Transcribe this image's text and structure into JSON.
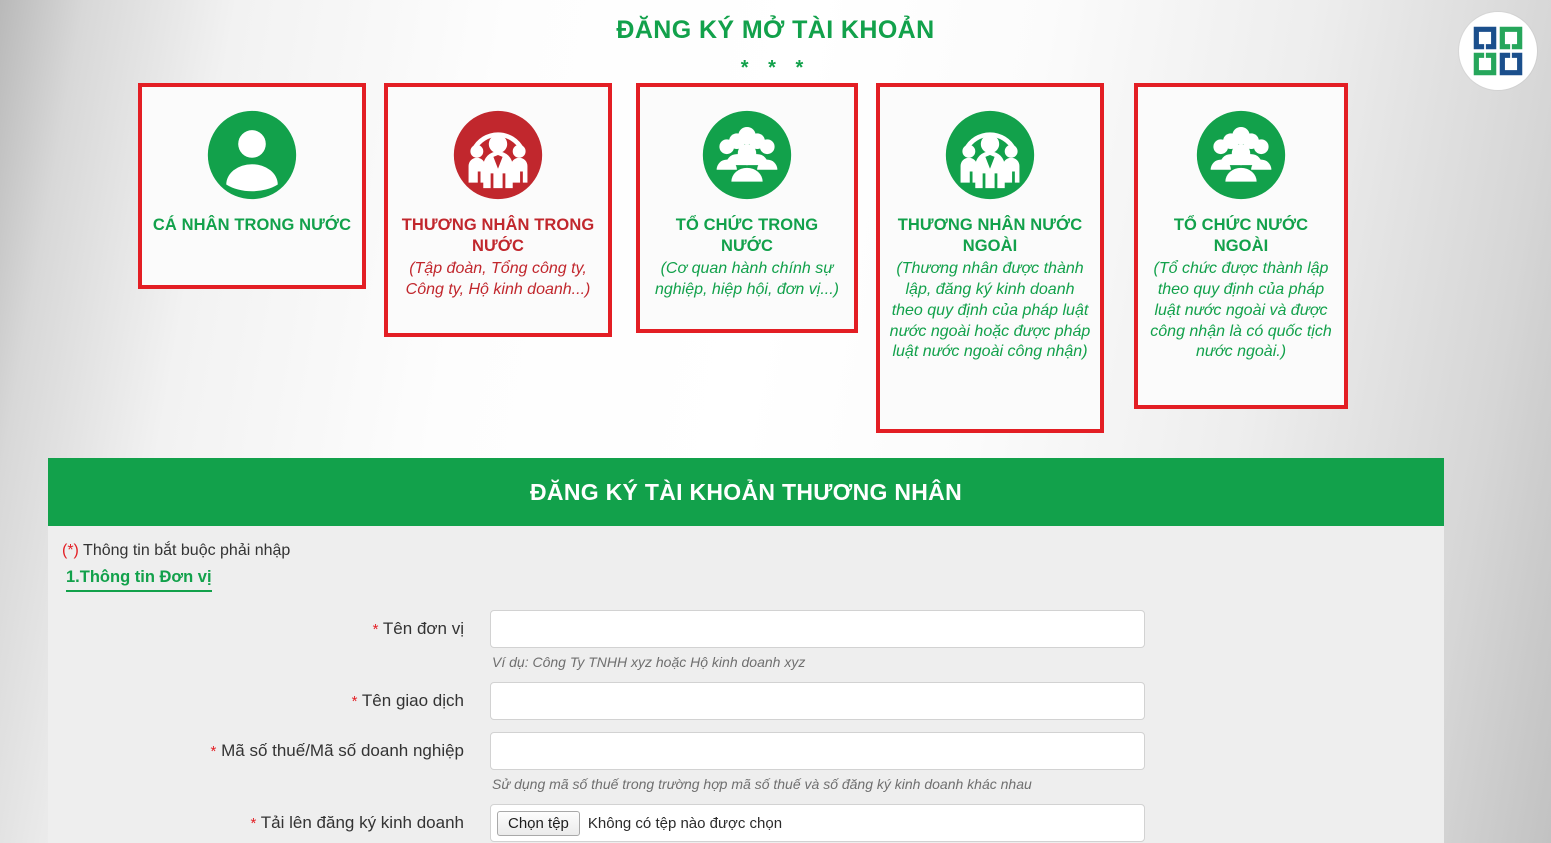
{
  "brand": {
    "logo_icon": "sgg-logo-icon",
    "logo_navy": "#1B4F8C",
    "logo_green": "#26A65B"
  },
  "colors": {
    "green": "#12A14B",
    "red_border": "#E31E24",
    "active_text": "#C1272D"
  },
  "header": {
    "title": "ĐĂNG KÝ MỞ TÀI KHOẢN",
    "stars": "* * *"
  },
  "categories": [
    {
      "id": "ca-nhan-trong-nuoc",
      "icon": "single-person-icon",
      "title": "CÁ NHÂN TRONG NƯỚC",
      "subtitle": "",
      "active": false
    },
    {
      "id": "thuong-nhan-trong-nuoc",
      "icon": "business-team-icon",
      "title": "THƯƠNG NHÂN TRONG NƯỚC",
      "subtitle": "(Tập đoàn, Tổng công ty, Công ty, Hộ kinh doanh...)",
      "active": true
    },
    {
      "id": "to-chuc-trong-nuoc",
      "icon": "crowd-group-icon",
      "title": "TỔ CHỨC TRONG NƯỚC",
      "subtitle": "(Cơ quan hành chính sự nghiệp, hiệp hội, đơn vị...)",
      "active": false
    },
    {
      "id": "thuong-nhan-nuoc-ngoai",
      "icon": "business-team-icon",
      "title": "THƯƠNG NHÂN NƯỚC NGOÀI",
      "subtitle": "(Thương nhân được thành lập, đăng ký kinh doanh theo quy định của pháp luật nước ngoài hoặc được pháp luật nước ngoài công nhận)",
      "active": false
    },
    {
      "id": "to-chuc-nuoc-ngoai",
      "icon": "crowd-group-icon",
      "title": "TỔ CHỨC NƯỚC NGOÀI",
      "subtitle": "(Tổ chức được thành lập theo quy định của pháp luật nước ngoài và được công nhận là có quốc tịch nước ngoài.)",
      "active": false
    }
  ],
  "panel": {
    "heading": "ĐĂNG KÝ TÀI KHOẢN THƯƠNG NHÂN",
    "required_marker": "(*)",
    "required_note": "Thông tin bắt buộc phải nhập",
    "section_title": "1.Thông tin Đơn vị"
  },
  "form": {
    "fields": [
      {
        "name": "ten-don-vi",
        "required_marker": "*",
        "label": "Tên đơn vị",
        "value": "",
        "placeholder": "",
        "hint": "Ví dụ: Công Ty TNHH xyz hoặc Hộ kinh doanh xyz",
        "type": "text"
      },
      {
        "name": "ten-giao-dich",
        "required_marker": "*",
        "label": "Tên giao dịch",
        "value": "",
        "placeholder": "",
        "hint": "",
        "type": "text"
      },
      {
        "name": "ma-so-thue",
        "required_marker": "*",
        "label": "Mã số thuế/Mã số doanh nghiệp",
        "value": "",
        "placeholder": "",
        "hint": "Sử dụng mã số thuế trong trường hợp mã số thuế và số đăng ký kinh doanh khác nhau",
        "type": "text"
      },
      {
        "name": "tai-len-dang-ky-kinh-doanh",
        "required_marker": "*",
        "label": "Tải lên đăng ký kinh doanh",
        "button_label": "Chọn tệp",
        "file_status": "Không có tệp nào được chọn",
        "hint": "",
        "type": "file"
      }
    ]
  }
}
